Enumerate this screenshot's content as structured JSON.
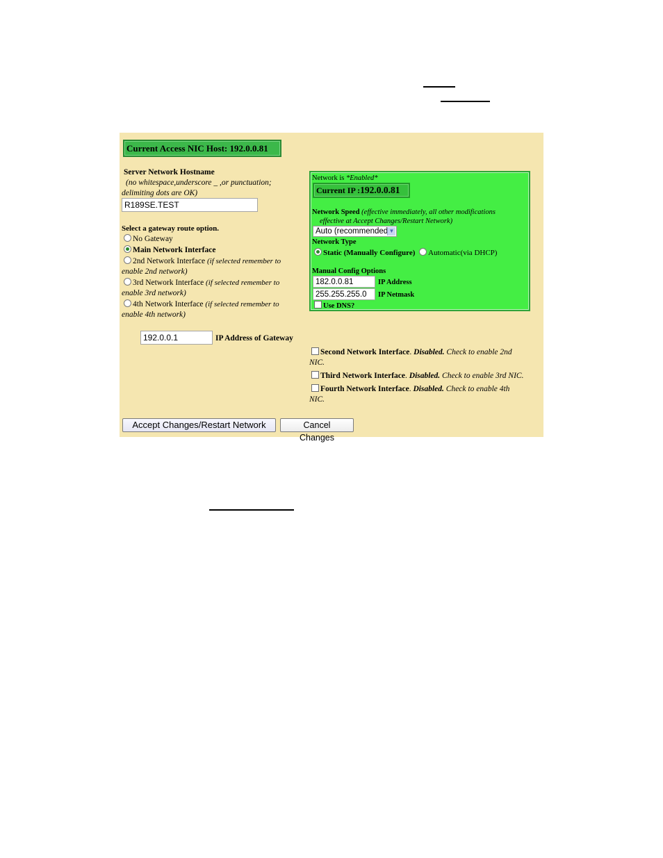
{
  "host_banner": {
    "label": "Current Access NIC Host:",
    "value": "192.0.0.81"
  },
  "hostname": {
    "title": "Server Network Hostname",
    "hint_line1": "(no whitespace,underscore _ ,or punctuation;",
    "hint_line2": "delimiting dots are OK)",
    "value": "R189SE.TEST"
  },
  "gateway": {
    "title": "Select a gateway route option.",
    "options": [
      {
        "label": "No Gateway",
        "note": "",
        "note_cont": "",
        "selected": false
      },
      {
        "label": "Main Network Interface",
        "note": "",
        "note_cont": "",
        "selected": true
      },
      {
        "label": "2nd Network Interface",
        "note": "(if selected remember to",
        "note_cont": "enable 2nd network)",
        "selected": false
      },
      {
        "label": "3rd Network Interface",
        "note": "(if selected remember to",
        "note_cont": "enable 3rd network)",
        "selected": false
      },
      {
        "label": "4th Network Interface",
        "note": "(if selected remember to",
        "note_cont": "enable 4th network)",
        "selected": false
      }
    ],
    "ip_value": "192.0.0.1",
    "ip_label": "IP Address of Gateway"
  },
  "main_nic": {
    "status_prefix": "Network is",
    "status_value": "*Enabled*",
    "current_ip_label": "Current IP :",
    "current_ip_value": "192.0.0.81",
    "speed_label": "Network Speed",
    "speed_note_line1": "(effective immediately, all other modifications",
    "speed_note_line2": "effective at Accept Changes/Restart Network)",
    "speed_selected": "Auto (recommended)",
    "type_label": "Network Type",
    "type_static": "Static (Manually Configure)",
    "type_dhcp": "Automatic(via DHCP)",
    "type_selected": "static",
    "manual_label": "Manual Config Options",
    "ip_address_value": "182.0.0.81",
    "ip_address_label": "IP Address",
    "netmask_value": "255.255.255.0",
    "netmask_label": "IP Netmask",
    "dns_label": "Use DNS?",
    "dns_checked": false
  },
  "other_nics": [
    {
      "name": "Second Network Interface",
      "state": "Disabled.",
      "hint": "Check to enable 2nd",
      "hint_cont": "NIC.",
      "checked": false
    },
    {
      "name": "Third Network Interface",
      "state": "Disabled.",
      "hint": "Check to enable 3rd NIC.",
      "hint_cont": "",
      "checked": false
    },
    {
      "name": "Fourth Network Interface",
      "state": "Disabled.",
      "hint": "Check to enable 4th",
      "hint_cont": "NIC.",
      "checked": false
    }
  ],
  "buttons": {
    "accept": "Accept Changes/Restart Network",
    "cancel": "Cancel Changes"
  },
  "colors": {
    "panel_bg": "#f5e6b0",
    "nic_panel_bg": "#44ee44",
    "banner_bg": "#3cb84a"
  }
}
